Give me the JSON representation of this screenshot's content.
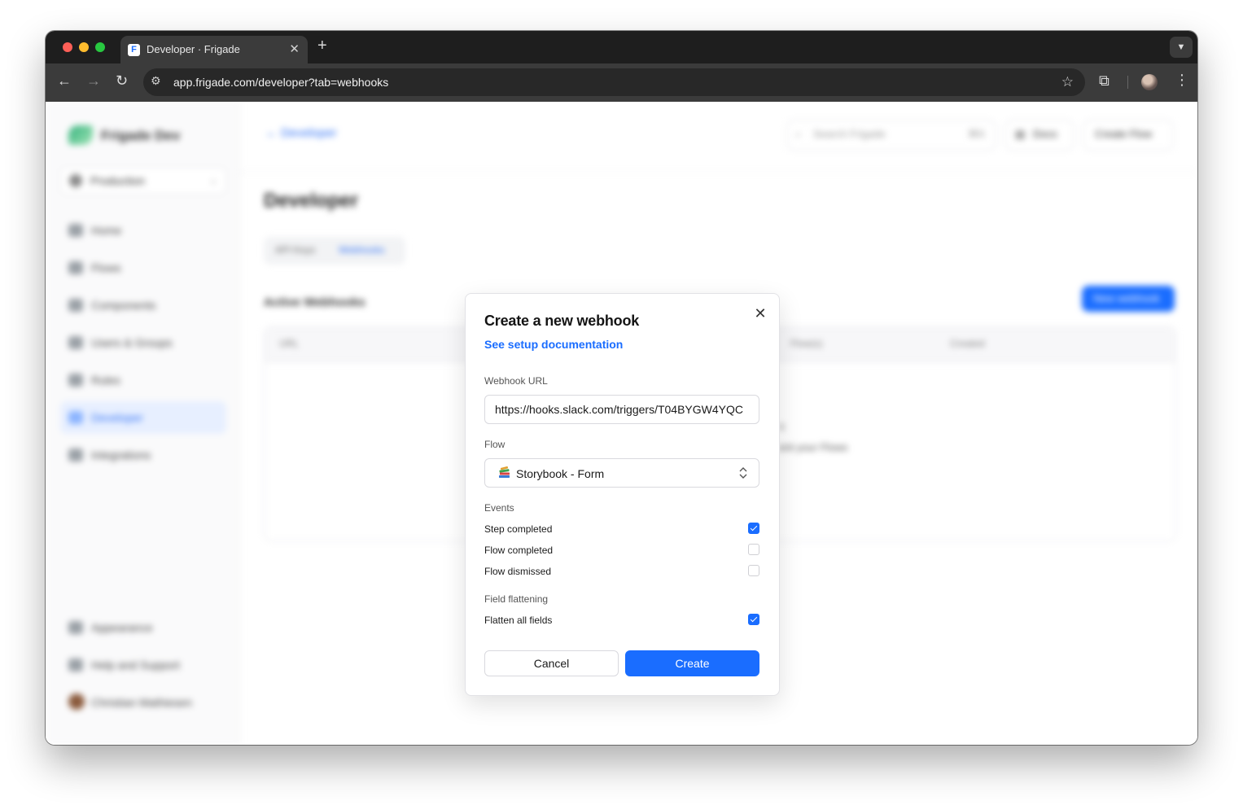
{
  "browser": {
    "tab_title": "Developer · Frigade",
    "favicon_letter": "F",
    "url": "app.frigade.com/developer?tab=webhooks"
  },
  "background_app": {
    "org_name": "Frigade Dev",
    "environment": "Production",
    "nav_items": [
      "Home",
      "Flows",
      "Components",
      "Users & Groups",
      "Rules",
      "Developer",
      "Integrations"
    ],
    "bottom_items": [
      "Appearance",
      "Help and Support",
      "Christian Mathiesen"
    ],
    "breadcrumb": "Developer",
    "search_placeholder": "Search Frigade",
    "search_shortcut": "⌘K",
    "docs_label": "Docs",
    "create_flow_label": "Create Flow",
    "page_title": "Developer",
    "tabs": [
      "API Keys",
      "Webhooks"
    ],
    "section_title": "Active Webhooks",
    "new_webhook_label": "New webhook",
    "table_columns": [
      "URL",
      "Flow(s)",
      "Created"
    ],
    "empty_line_1": "s",
    "empty_line_2": "ent your Flows"
  },
  "modal": {
    "title": "Create a new webhook",
    "docs_link": "See setup documentation",
    "webhook_url_label": "Webhook URL",
    "webhook_url_value": "https://hooks.slack.com/triggers/T04BYGW4YQC",
    "flow_label": "Flow",
    "flow_value": "Storybook - Form",
    "events_label": "Events",
    "events": [
      {
        "label": "Step completed",
        "checked": true
      },
      {
        "label": "Flow completed",
        "checked": false
      },
      {
        "label": "Flow dismissed",
        "checked": false
      }
    ],
    "flattening_label": "Field flattening",
    "flatten_option": {
      "label": "Flatten all fields",
      "checked": true
    },
    "cancel_label": "Cancel",
    "create_label": "Create"
  },
  "colors": {
    "accent": "#1a6dff",
    "chrome_dark": "#1e1e1e",
    "chrome_toolbar": "#3b3b3b"
  }
}
